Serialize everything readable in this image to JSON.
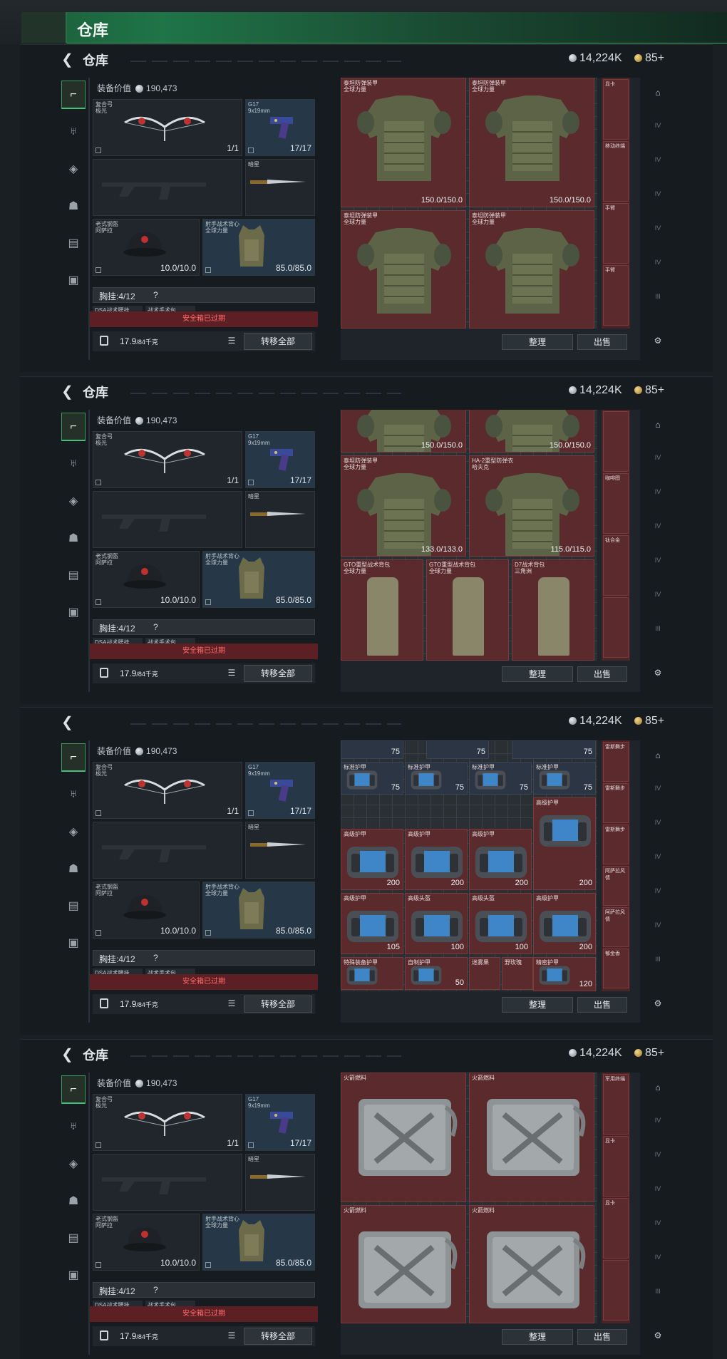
{
  "page": {
    "title": "仓库"
  },
  "panels": [
    {
      "header": "仓库",
      "silver": "14,224K",
      "gold": "85+",
      "equip_value_label": "装备价值",
      "equip_value": "190,473",
      "bow_name": "复合弓",
      "bow_sub": "极光",
      "bow_count": "1/1",
      "pistol_name": "G17",
      "pistol_sub": "9x19mm",
      "pistol_count": "17/17",
      "knife_name": "暗星",
      "helmet_name": "老式钢盔",
      "helmet_sub": "阿萨拉",
      "helmet_dur": "10.0/10.0",
      "vest_name": "射手战术背心",
      "vest_sub": "全球力量",
      "vest_dur": "85.0/85.0",
      "chest_label": "胸挂:",
      "chest_count": "4/12",
      "chest_q": "?",
      "mini1": "DSA战术腰挂",
      "mini2": "战术手术包",
      "warning": "安全箱已过期",
      "weight": "17.9",
      "weight_unit": "/84千克",
      "transfer": "转移全部",
      "sort": "整理",
      "sell": "出售",
      "cells": [
        {
          "nm": "泰坦防弹装甲\n全球力量",
          "dur": "150.0/150.0"
        },
        {
          "nm": "泰坦防弹装甲\n全球力量",
          "dur": "150.0/150.0"
        },
        {
          "nm": "泰坦防弹装甲\n全球力量",
          "dur": ""
        },
        {
          "nm": "泰坦防弹装甲\n全球力量",
          "dur": ""
        }
      ],
      "strip": [
        "显卡",
        "移动终端",
        "手臂",
        "手臂"
      ]
    },
    {
      "header": "仓库",
      "silver": "14,224K",
      "gold": "85+",
      "equip_value_label": "装备价值",
      "equip_value": "190,473",
      "bow_name": "复合弓",
      "bow_sub": "极光",
      "bow_count": "1/1",
      "pistol_name": "G17",
      "pistol_sub": "9x19mm",
      "pistol_count": "17/17",
      "knife_name": "暗星",
      "helmet_name": "老式钢盔",
      "helmet_sub": "阿萨拉",
      "helmet_dur": "10.0/10.0",
      "vest_name": "射手战术背心",
      "vest_sub": "全球力量",
      "vest_dur": "85.0/85.0",
      "chest_label": "胸挂:",
      "chest_count": "4/12",
      "chest_q": "?",
      "mini1": "DSA战术腰挂",
      "mini2": "战术手术包",
      "warning": "安全箱已过期",
      "weight": "17.9",
      "weight_unit": "/84千克",
      "transfer": "转移全部",
      "sort": "整理",
      "sell": "出售",
      "cells": [
        {
          "nm": "",
          "dur": "150.0/150.0"
        },
        {
          "nm": "",
          "dur": "150.0/150.0"
        },
        {
          "nm": "泰坦防弹装甲\n全球力量",
          "dur": "133.0/133.0"
        },
        {
          "nm": "HA-2重型防弹衣\n哈夫克",
          "dur": "115.0/115.0"
        }
      ],
      "strip": [
        "",
        "咖啡图",
        "钛合金",
        ""
      ],
      "bottom_cells": [
        "GTO重型战术背包\n全球力量",
        "GTO重型战术背包\n全球力量",
        "D7战术背包\n三角洲"
      ]
    },
    {
      "header": "",
      "silver": "14,224K",
      "gold": "85+",
      "equip_value_label": "装备价值",
      "equip_value": "190,473",
      "bow_name": "复合弓",
      "bow_sub": "极光",
      "bow_count": "1/1",
      "pistol_name": "G17",
      "pistol_sub": "9x19mm",
      "pistol_count": "17/17",
      "knife_name": "暗星",
      "helmet_name": "老式钢盔",
      "helmet_sub": "阿萨拉",
      "helmet_dur": "10.0/10.0",
      "vest_name": "射手战术背心",
      "vest_sub": "全球力量",
      "vest_dur": "85.0/85.0",
      "chest_label": "胸挂:",
      "chest_count": "4/12",
      "chest_q": "?",
      "mini1": "DSA战术腰挂",
      "mini2": "战术手术包",
      "warning": "安全箱已过期",
      "weight": "17.9",
      "weight_unit": "/84千克",
      "transfer": "转移全部",
      "sort": "整理",
      "sell": "出售",
      "plates": [
        {
          "nm": "",
          "v": "75"
        },
        {
          "nm": "",
          "v": "75"
        },
        {
          "nm": "",
          "v": "75"
        },
        {
          "nm": "标准护甲",
          "v": "75"
        },
        {
          "nm": "标准护甲",
          "v": "75"
        },
        {
          "nm": "标准护甲",
          "v": "75"
        },
        {
          "nm": "标准护甲",
          "v": "75"
        },
        {
          "nm": "高级护甲",
          "v": "200"
        },
        {
          "nm": "高级护甲",
          "v": "200"
        },
        {
          "nm": "高级护甲",
          "v": "200"
        },
        {
          "nm": "高级护甲",
          "v": "200"
        },
        {
          "nm": "高级护甲",
          "v": "105"
        },
        {
          "nm": "高级头盔",
          "v": "100"
        },
        {
          "nm": "高级头盔",
          "v": "100"
        },
        {
          "nm": "高级护甲",
          "v": "200"
        },
        {
          "nm": "特殊装备护甲",
          "v": ""
        },
        {
          "nm": "自制护甲",
          "v": "50"
        },
        {
          "nm": "迷雾果",
          "v": ""
        },
        {
          "nm": "野玫瑰",
          "v": ""
        },
        {
          "nm": "精密护甲",
          "v": "120"
        }
      ],
      "strip": [
        "雷斯舞步",
        "雷斯舞步",
        "雷斯舞步",
        "阿萨拉风情",
        "阿萨拉风情",
        "郁金香"
      ]
    },
    {
      "header": "仓库",
      "silver": "14,224K",
      "gold": "85+",
      "equip_value_label": "装备价值",
      "equip_value": "190,473",
      "bow_name": "复合弓",
      "bow_sub": "极光",
      "bow_count": "1/1",
      "pistol_name": "G17",
      "pistol_sub": "9x19mm",
      "pistol_count": "17/17",
      "knife_name": "暗星",
      "helmet_name": "老式钢盔",
      "helmet_sub": "阿萨拉",
      "helmet_dur": "10.0/10.0",
      "vest_name": "射手战术背心",
      "vest_sub": "全球力量",
      "vest_dur": "85.0/85.0",
      "chest_label": "胸挂:",
      "chest_count": "4/12",
      "chest_q": "?",
      "mini1": "DSA战术腰挂",
      "mini2": "战术手术包",
      "warning": "安全箱已过期",
      "weight": "17.9",
      "weight_unit": "/84千克",
      "transfer": "转移全部",
      "sort": "整理",
      "sell": "出售",
      "cells": [
        {
          "nm": "火箭燃料",
          "dur": ""
        },
        {
          "nm": "火箭燃料",
          "dur": ""
        },
        {
          "nm": "火箭燃料",
          "dur": ""
        },
        {
          "nm": "火箭燃料",
          "dur": ""
        }
      ],
      "strip": [
        "军用终端",
        "显卡",
        "显卡",
        ""
      ]
    }
  ]
}
